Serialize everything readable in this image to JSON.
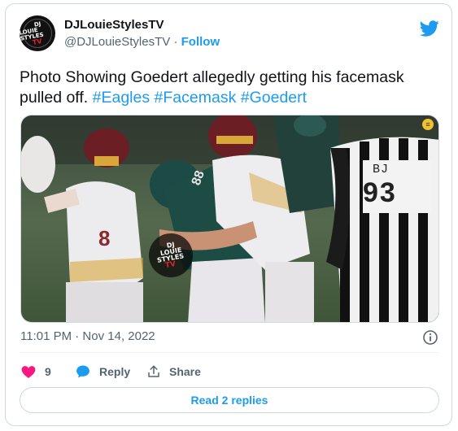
{
  "tweet": {
    "author": {
      "display_name": "DJLouieStylesTV",
      "handle": "@DJLouieStylesTV",
      "separator": "·",
      "follow_label": "Follow",
      "avatar_text": [
        "DJ",
        "LOUIE STYLES",
        "TV"
      ]
    },
    "text": {
      "body": "Photo Showing Goedert allegedly getting his facemask pulled off.",
      "hashtags": [
        "#Eagles",
        "#Facemask",
        "#Goedert"
      ]
    },
    "media": {
      "watermark": [
        "DJ",
        "LOUIE",
        "STYLES",
        "TV"
      ],
      "jersey_label": "BJ",
      "jersey_number": "93",
      "player_number": "88"
    },
    "timestamp": "11:01 PM · Nov 14, 2022",
    "actions": {
      "like_count": "9",
      "reply_label": "Reply",
      "share_label": "Share"
    },
    "read_replies_label": "Read 2 replies"
  },
  "colors": {
    "accent": "#1d9bf0",
    "like": "#f91880",
    "secondary_text": "#536471",
    "border": "#cfd9de"
  },
  "icons": [
    "twitter-bird-icon",
    "info-icon",
    "heart-icon",
    "reply-bubble-icon",
    "share-icon"
  ]
}
